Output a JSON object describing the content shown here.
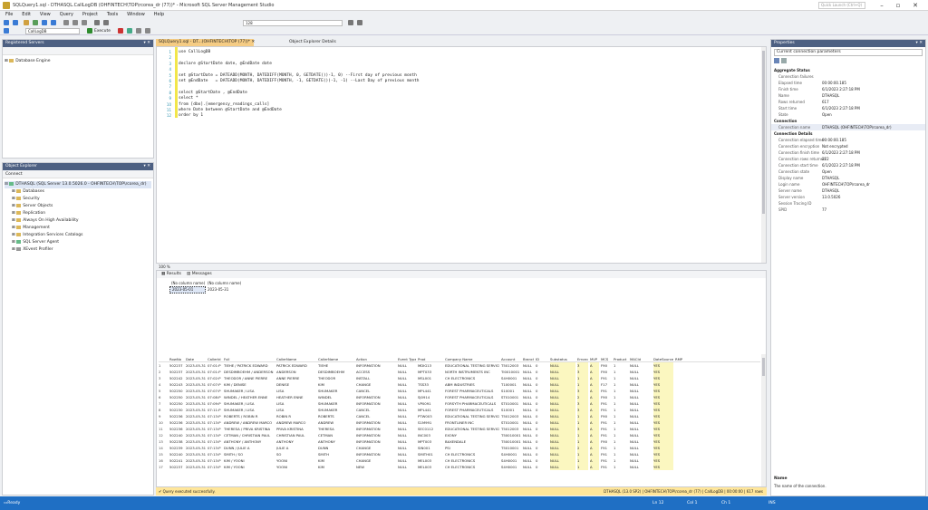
{
  "title": "SQLQuery1.sql - DTHASQL.CallLogDB (OHFINTECH\\TOP\\rcorea_dr (77))* - Microsoft SQL Server Management Studio",
  "quick_launch": "Quick Launch (Ctrl+Q)",
  "menu": [
    "File",
    "Edit",
    "View",
    "Query",
    "Project",
    "Tools",
    "Window",
    "Help"
  ],
  "toolbar": {
    "server_combo": "128",
    "db_combo": "CallLogDB",
    "execute_label": "Execute"
  },
  "registered_servers": {
    "title": "Registered Servers",
    "root": "Database Engine"
  },
  "object_explorer": {
    "title": "Object Explorer",
    "connect": "Connect",
    "server": "DTHASQL (SQL Server 13.0.5026.0 - OHFINTECH\\TOP\\rcorea_dr)",
    "items": [
      "Databases",
      "Security",
      "Server Objects",
      "Replication",
      "Always On High Availability",
      "Management",
      "Integration Services Catalogs",
      "SQL Server Agent",
      "XEvent Profiler"
    ]
  },
  "tabs": [
    {
      "label": "SQLQuery1.sql - DT...(OHFINTECH\\TOP (77))*"
    },
    {
      "label": "Object Explorer Details"
    }
  ],
  "code_lines": [
    "use CallLogDB",
    "",
    "declare @StartDate date, @EndDate date",
    "",
    "set @StartDate = DATEADD(MONTH, DATEDIFF(MONTH, 0, GETDATE())-1, 0) --First day of previous month",
    "set @EndDate   = DATEADD(MONTH, DATEDIFF(MONTH, -1, GETDATE())-1, -1) --Last Day of previous month",
    "",
    "select @StartDate , @EndDate",
    "select *",
    "from [dbo].[emergency_readings_calls]",
    "where Date between @StartDate and @EndDate",
    "order by 1"
  ],
  "zoom": "100 %",
  "results": {
    "tab_results": "Results",
    "tab_messages": "Messages",
    "grid1_headers": [
      "(No column name)",
      "(No column name)"
    ],
    "grid1_row": [
      "2023-05-01",
      "2023-05-31"
    ],
    "grid2_headers": [
      "RowNo",
      "Date",
      "CallerId",
      "Full",
      "CallerName",
      "CallerName",
      "Action",
      "Event Type",
      "Prod",
      "Company Name",
      "Account",
      "Branch",
      "ID",
      "Substatus",
      "Errorcode",
      "MVP",
      "MCS",
      "Product",
      "MACId",
      "DateSource",
      "RMP"
    ],
    "grid2_rows": [
      [
        "1",
        "502237",
        "2023-05-31",
        "07:01:P",
        "TIEHE / PATRICK EDWARD",
        "PATRICK EDWARD",
        "TIEHE",
        "INFORMATION",
        "NULL",
        "MDIG13",
        "EDUCATIONAL TESTING SERVICES",
        "T5012003",
        "NULL",
        "0",
        "NULL",
        "3",
        "A",
        "F90",
        "1",
        "NULL",
        "YES"
      ],
      [
        "2",
        "502237",
        "2023-05-31",
        "07:01:P",
        "DESDIMBOEHM / ANDERSON",
        "ANDERSON",
        "DESDIMBOEHM",
        "ACCESS",
        "NULL",
        "MPT033",
        "NORTH INSTRUMENTS INC",
        "TI0010001",
        "NULL",
        "0",
        "NULL",
        "3",
        "A",
        "F90",
        "1",
        "NULL",
        "YES"
      ],
      [
        "3",
        "502242",
        "2023-05-31",
        "07:02:P",
        "THEODOR / ANNE PIERRE",
        "ANNE PIERRE",
        "THEODOR",
        "INSTALL",
        "NULL",
        "MSL001",
        "CH ELECTRONICS",
        "S4H0001",
        "NULL",
        "0",
        "NULL",
        "1",
        "A",
        "F91",
        "1",
        "NULL",
        "YES"
      ],
      [
        "4",
        "502243",
        "2023-05-31",
        "07:07:P",
        "KIM / DENISE",
        "DENISE",
        "KIM",
        "CHANGE",
        "NULL",
        "TSS33",
        "ABM INDUSTRIES",
        "T100001",
        "NULL",
        "0",
        "NULL",
        "1",
        "A",
        "F17",
        "1",
        "NULL",
        "YES"
      ],
      [
        "5",
        "502250",
        "2023-05-31",
        "07:07:P",
        "SHUMAKER / LISA",
        "LISA",
        "SHUMAKER",
        "CANCEL",
        "NULL",
        "MPL441",
        "FOREST PHARMACEUTICALS",
        "S10001",
        "NULL",
        "0",
        "NULL",
        "3",
        "A",
        "F91",
        "1",
        "NULL",
        "YES"
      ],
      [
        "6",
        "502250",
        "2023-05-31",
        "07:08:P",
        "WINDEL / HEATHER ENNE",
        "HEATHER ENNE",
        "WINDEL",
        "INFORMATION",
        "NULL",
        "SJ0914",
        "FOREST PHARMACEUTICALS",
        "ST010001",
        "NULL",
        "0",
        "NULL",
        "2",
        "A",
        "F90",
        "1",
        "NULL",
        "YES"
      ],
      [
        "7",
        "502250",
        "2023-05-31",
        "07:09:P",
        "SHUMAKER / LISA",
        "LISA",
        "SHUMAKER",
        "INFORMATION",
        "NULL",
        "VP0091",
        "FORSYTH PHARMACEUTICALS",
        "ST010001",
        "NULL",
        "0",
        "NULL",
        "3",
        "A",
        "F91",
        "1",
        "NULL",
        "YES"
      ],
      [
        "8",
        "502230",
        "2023-05-31",
        "07:11:P",
        "SHUMAKER / LISA",
        "LISA",
        "SHUMAKER",
        "CANCEL",
        "NULL",
        "MPL441",
        "FOREST PHARMACEUTICALS",
        "S10001",
        "NULL",
        "0",
        "NULL",
        "3",
        "A",
        "F91",
        "1",
        "NULL",
        "YES"
      ],
      [
        "9",
        "502236",
        "2023-05-31",
        "07:13:P",
        "ROBERTS / ROBIN R",
        "ROBIN R",
        "ROBERTS",
        "CANCEL",
        "NULL",
        "PTW003",
        "EDUCATIONAL TESTING SERVICES",
        "T5012003",
        "NULL",
        "0",
        "NULL",
        "1",
        "A",
        "F90",
        "1",
        "NULL",
        "YES"
      ],
      [
        "10",
        "502236",
        "2023-05-31",
        "07:13:P",
        "ANDREW / ANDREW MARCO",
        "ANDREW MARCO",
        "ANDREW",
        "INFORMATION",
        "NULL",
        "S1M991",
        "FRONTLINER INC",
        "ST010001",
        "NULL",
        "0",
        "NULL",
        "1",
        "A",
        "F91",
        "1",
        "NULL",
        "YES"
      ],
      [
        "11",
        "502236",
        "2023-05-31",
        "07:13:P",
        "THERESA / PRIVA KRISTINA",
        "PRIVA KRISTINA",
        "THERESA",
        "INFORMATION",
        "NULL",
        "SEC0112",
        "EDUCATIONAL TESTING SERVICES",
        "T5012003",
        "NULL",
        "0",
        "NULL",
        "3",
        "A",
        "F91",
        "1",
        "NULL",
        "YES"
      ],
      [
        "12",
        "502240",
        "2023-05-31",
        "07:13:P",
        "CETMAN / CHRISTIAN PAUL",
        "CHRISTIAN PAUL",
        "CETMAN",
        "INFORMATION",
        "NULL",
        "INC003",
        "EXONY",
        "T50010001",
        "NULL",
        "0",
        "NULL",
        "1",
        "A",
        "F91",
        "1",
        "NULL",
        "YES"
      ],
      [
        "13",
        "502238",
        "2023-05-31",
        "07:13:P",
        "ANTHONY / ANTHONY",
        "ANTHONY",
        "ANTHONY",
        "INFORMATION",
        "NULL",
        "MPT003",
        "BAXENDALE",
        "T50010001",
        "NULL",
        "0",
        "NULL",
        "1",
        "A",
        "F90",
        "1",
        "NULL",
        "YES"
      ],
      [
        "14",
        "502239",
        "2023-05-31",
        "07:13:P",
        "DUNN / JULIE A",
        "JULIE A",
        "DUNN",
        "CHANGE",
        "NULL",
        "SIN001",
        "PSI",
        "T5010001",
        "NULL",
        "0",
        "NULL",
        "2",
        "A",
        "F91",
        "1",
        "NULL",
        "YES"
      ],
      [
        "15",
        "502240",
        "2023-05-31",
        "07:13:P",
        "SMITH / SO",
        "SO",
        "SMITH",
        "INFORMATION",
        "NULL",
        "SMITH01",
        "CH ELECTRONICS",
        "S4H0001",
        "NULL",
        "0",
        "NULL",
        "1",
        "A",
        "F91",
        "1",
        "NULL",
        "YES"
      ],
      [
        "16",
        "502241",
        "2023-05-31",
        "07:13:P",
        "KIM / YOONI",
        "YOONI",
        "KIM",
        "CHANGE",
        "NULL",
        "MEL003",
        "CH ELECTRONICS",
        "S4H0001",
        "NULL",
        "0",
        "NULL",
        "1",
        "A",
        "F91",
        "1",
        "NULL",
        "YES"
      ],
      [
        "17",
        "502237",
        "2023-05-31",
        "07:13:P",
        "KIM / YOONI",
        "YOONI",
        "KIM",
        "NEW",
        "NULL",
        "MEL003",
        "CH ELECTRONICS",
        "S4H0001",
        "NULL",
        "0",
        "NULL",
        "1",
        "A",
        "F91",
        "1",
        "NULL",
        "YES"
      ]
    ]
  },
  "query_status": {
    "message": "Query executed successfully.",
    "server": "DTHASQL (13.0 SP2)",
    "user": "OHFINTECH\\TOP\\rcorea_dr (77)",
    "db": "CallLogDB",
    "time": "00:00:00",
    "rows": "617 rows"
  },
  "properties": {
    "title": "Properties",
    "combo": "Current connection parameters",
    "rows": [
      {
        "k": "Aggregate Status",
        "v": "",
        "cat": true
      },
      {
        "k": "Connection failures",
        "v": ""
      },
      {
        "k": "Elapsed time",
        "v": "00:00:00.185"
      },
      {
        "k": "Finish time",
        "v": "6/1/2023 2:27:18 PM"
      },
      {
        "k": "Name",
        "v": "DTHASQL"
      },
      {
        "k": "Rows returned",
        "v": "617"
      },
      {
        "k": "Start time",
        "v": "6/1/2023 2:27:18 PM"
      },
      {
        "k": "State",
        "v": "Open"
      },
      {
        "k": "Connection",
        "v": "",
        "cat": true
      },
      {
        "k": "Connection name",
        "v": "DTHASQL (OHFINTECH\\TOP\\rcorea_dr)",
        "sel": true
      },
      {
        "k": "Connection Details",
        "v": "",
        "cat": true
      },
      {
        "k": "Connection elapsed time",
        "v": "00:00:00.185"
      },
      {
        "k": "Connection encryption",
        "v": "Not encrypted"
      },
      {
        "k": "Connection finish time",
        "v": "6/1/2023 2:27:18 PM"
      },
      {
        "k": "Connection rows returned",
        "v": "222"
      },
      {
        "k": "Connection start time",
        "v": "6/1/2023 2:27:18 PM"
      },
      {
        "k": "Connection state",
        "v": "Open"
      },
      {
        "k": "Display name",
        "v": "DTHASQL"
      },
      {
        "k": "Login name",
        "v": "OHFINTECH\\TOP\\rcorea_dr"
      },
      {
        "k": "Server name",
        "v": "DTHASQL"
      },
      {
        "k": "Server version",
        "v": "13.0.5026"
      },
      {
        "k": "Session Tracing ID",
        "v": ""
      },
      {
        "k": "SPID",
        "v": "77"
      }
    ],
    "desc_title": "Name",
    "desc_text": "The name of the connection."
  },
  "statusbar": {
    "ready": "Ready",
    "ln": "Ln 12",
    "col": "Col 1",
    "ch": "Ch 1",
    "ins": "INS"
  },
  "colors": {
    "accent": "#1f6fc4",
    "panel_header": "#4d6082",
    "active_tab": "#f5cc84",
    "status_yellow": "#ffe69a"
  }
}
